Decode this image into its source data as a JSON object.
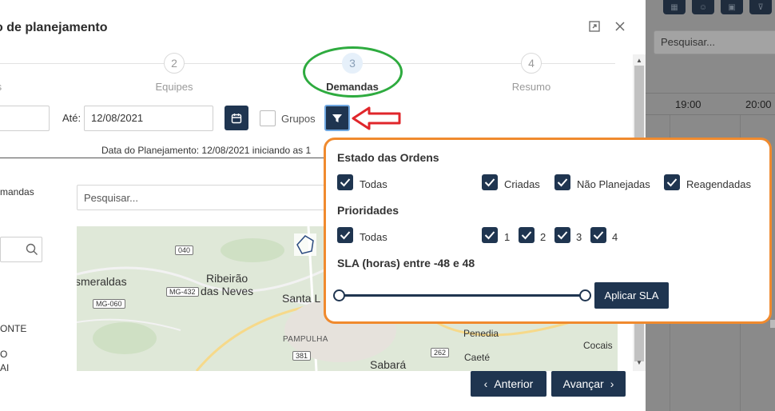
{
  "modal": {
    "title": "o de planejamento",
    "maximize_icon": "expand-icon",
    "close_icon": "close-icon"
  },
  "stepper": [
    {
      "num": "",
      "label": "erais"
    },
    {
      "num": "2",
      "label": "Equipes"
    },
    {
      "num": "3",
      "label": "Demandas"
    },
    {
      "num": "4",
      "label": "Resumo"
    }
  ],
  "filters": {
    "ate_label": "Até:",
    "ate_value": "12/08/2021",
    "grupos_label": "Grupos"
  },
  "plan_date_text": "Data do Planejamento: 12/08/2021 iniciando as 1",
  "left_panel": {
    "demandas": "mandas",
    "text1": "ONTE",
    "text2": "O",
    "text3": "AI"
  },
  "search": {
    "placeholder": "Pesquisar..."
  },
  "map": {
    "labels": [
      "smeraldas",
      "Ribeirão",
      "das Neves",
      "Santa L",
      "PAMPULHA",
      "Sabará",
      "Penedia",
      "Caeté",
      "Cocais"
    ],
    "shields": [
      "040",
      "MG-432",
      "MG-060",
      "381",
      "262"
    ]
  },
  "popover": {
    "estado_title": "Estado das Ordens",
    "estado_options": [
      "Todas",
      "Criadas",
      "Não Planejadas",
      "Reagendadas"
    ],
    "prioridades_title": "Prioridades",
    "prioridades_options": [
      "Todas",
      "1",
      "2",
      "3",
      "4"
    ],
    "sla_title": "SLA (horas) entre -48 e 48",
    "sla_min": -48,
    "sla_max": 48,
    "sla_button": "Aplicar SLA"
  },
  "footer": {
    "anterior": "Anterior",
    "avancar": "Avançar"
  },
  "background_app": {
    "search_placeholder": "Pesquisar...",
    "times": [
      "19:00",
      "20:00"
    ]
  },
  "colors": {
    "primary": "#1f3550",
    "annotation_green": "#2eab3f",
    "annotation_red": "#e0262b",
    "annotation_orange": "#f08a2e"
  }
}
